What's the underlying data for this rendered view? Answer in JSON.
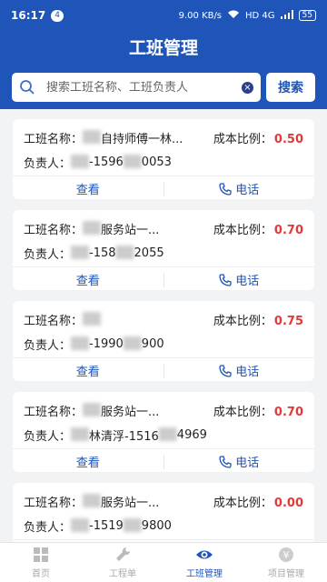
{
  "status": {
    "time": "16:17",
    "notif": "4",
    "speed": "9.00 KB/s",
    "network": "HD 4G",
    "battery": "55"
  },
  "header": {
    "title": "工班管理"
  },
  "search": {
    "placeholder": "搜索工班名称、工班负责人",
    "button": "搜索"
  },
  "labels": {
    "name": "工班名称：",
    "leader": "负责人：",
    "ratio": "成本比例：",
    "view": "查看",
    "phone": "电话"
  },
  "cards": [
    {
      "name": "自持师傅一林...",
      "leader": "-1596",
      "leader_tail": "0053",
      "ratio": "0.50"
    },
    {
      "name": "服务站一...",
      "leader": "-158",
      "leader_tail": "2055",
      "ratio": "0.70"
    },
    {
      "name": "",
      "leader": "-1990",
      "leader_tail": "900",
      "ratio": "0.75"
    },
    {
      "name": "服务站一...",
      "leader": "林清浮-1516",
      "leader_tail": "4969",
      "ratio": "0.70"
    },
    {
      "name": "服务站一...",
      "leader": "-1519",
      "leader_tail": "9800",
      "ratio": "0.00"
    }
  ],
  "tabs": [
    {
      "label": "首页",
      "icon": "grid-icon"
    },
    {
      "label": "工程单",
      "icon": "wrench-icon"
    },
    {
      "label": "工班管理",
      "icon": "eye-icon"
    },
    {
      "label": "项目管理",
      "icon": "yen-icon"
    }
  ],
  "colors": {
    "primary": "#1f55b8",
    "ratio": "#e23a3a",
    "bg": "#f2f3f5"
  }
}
